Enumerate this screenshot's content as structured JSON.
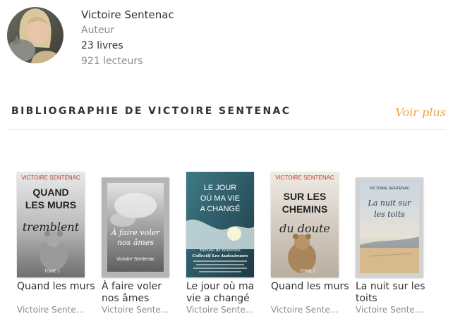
{
  "author": {
    "name": "Victoire Sentenac",
    "role": "Auteur",
    "books_count": "23 livres",
    "readers_count": "921 lecteurs"
  },
  "section": {
    "title": "BIBLIOGRAPHIE DE VICTOIRE SENTENAC",
    "see_more": "Voir plus"
  },
  "books": [
    {
      "title": "Quand les murs",
      "author": "Victoire Sente…",
      "cover_text": {
        "top": "VICTOIRE SENTENAC",
        "main": "QUAND LES MURS",
        "script": "tremblent",
        "tome": "TOME 1"
      }
    },
    {
      "title": "À faire voler nos âmes",
      "author": "Victoire Sente…",
      "cover_text": {
        "script": "À faire voler nos âmes",
        "author": "Victoire Sentenac"
      }
    },
    {
      "title": "Le jour où ma vie a changé",
      "author": "Victoire Sente…",
      "cover_text": {
        "main": "LE JOUR OÙ MA VIE A CHANGÉ",
        "sub1": "Recueil de nouvelles",
        "sub2": "Collectif Les Audacieuses"
      }
    },
    {
      "title": "Quand les murs",
      "author": "Victoire Sente…",
      "cover_text": {
        "top": "VICTOIRE SENTENAC",
        "main": "SUR LES CHEMINS",
        "script": "du doute",
        "tome": "TOME 2"
      }
    },
    {
      "title": "La nuit sur les toits",
      "author": "Victoire Sente…",
      "cover_text": {
        "top": "VICTOIRE SENTENAC",
        "script": "La nuit sur les toits"
      }
    }
  ],
  "colors": {
    "accent": "#f0a03c",
    "red_title": "#c0392b",
    "text": "#333333",
    "muted": "#8a8a8a"
  }
}
